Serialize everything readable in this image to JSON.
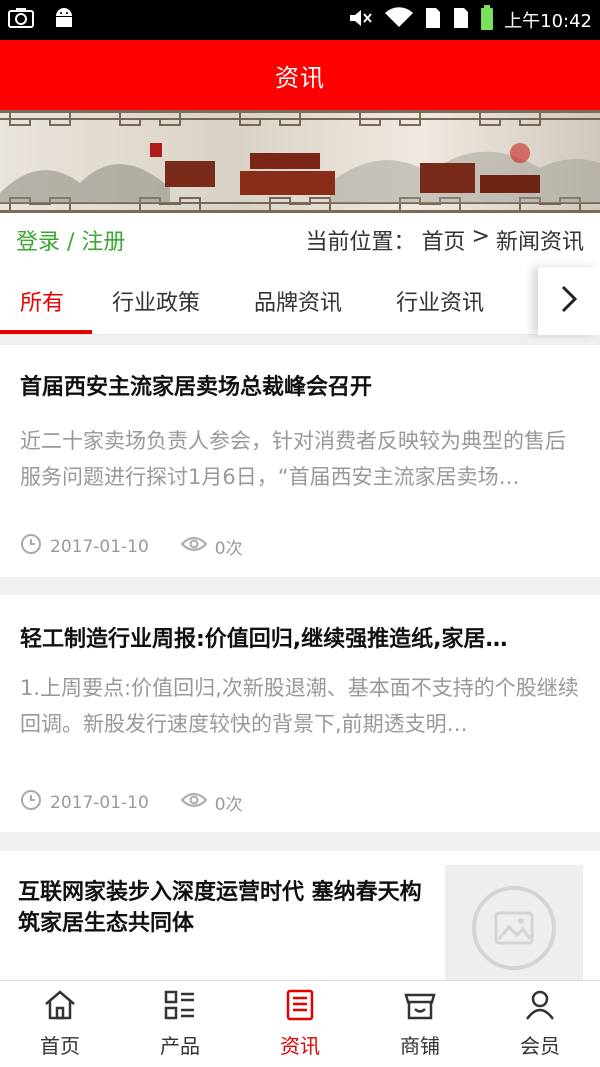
{
  "status_bar": {
    "time": "上午10:42",
    "icons": [
      "screenshot-icon",
      "android-icon",
      "mute-icon",
      "wifi-icon",
      "sim1-icon",
      "sim2-icon",
      "battery-icon"
    ]
  },
  "header": {
    "title": "资讯"
  },
  "auth": {
    "login_register": "登录 / 注册"
  },
  "breadcrumb": {
    "prefix": "当前位置：",
    "home": "首页",
    "separator": ">",
    "current": "新闻资讯"
  },
  "tabs": [
    {
      "label": "所有",
      "active": true
    },
    {
      "label": "行业政策",
      "active": false
    },
    {
      "label": "品牌资讯",
      "active": false
    },
    {
      "label": "行业资讯",
      "active": false
    }
  ],
  "news": [
    {
      "title": "首届西安主流家居卖场总裁峰会召开",
      "desc": "近二十家卖场负责人参会，针对消费者反映较为典型的售后服务问题进行探讨1月6日，“首届西安主流家居卖场…",
      "date": "2017-01-10",
      "views": "0次"
    },
    {
      "title": "轻工制造行业周报:价值回归,继续强推造纸,家居…",
      "desc": "1.上周要点:价值回归,次新股退潮、基本面不支持的个股继续回调。新股发行速度较快的背景下,前期透支明…",
      "date": "2017-01-10",
      "views": "0次"
    },
    {
      "title": "互联网家装步入深度运营时代 塞纳春天构筑家居生态共同体"
    }
  ],
  "bottom_nav": [
    {
      "label": "首页",
      "icon": "home-icon",
      "active": false
    },
    {
      "label": "产品",
      "icon": "grid-list-icon",
      "active": false
    },
    {
      "label": "资讯",
      "icon": "news-icon",
      "active": true
    },
    {
      "label": "商铺",
      "icon": "shop-icon",
      "active": false
    },
    {
      "label": "会员",
      "icon": "user-icon",
      "active": false
    }
  ],
  "colors": {
    "brand_red": "#ff0000",
    "active_red": "#e60000",
    "login_green": "#3ca832",
    "muted_gray": "#999999"
  }
}
